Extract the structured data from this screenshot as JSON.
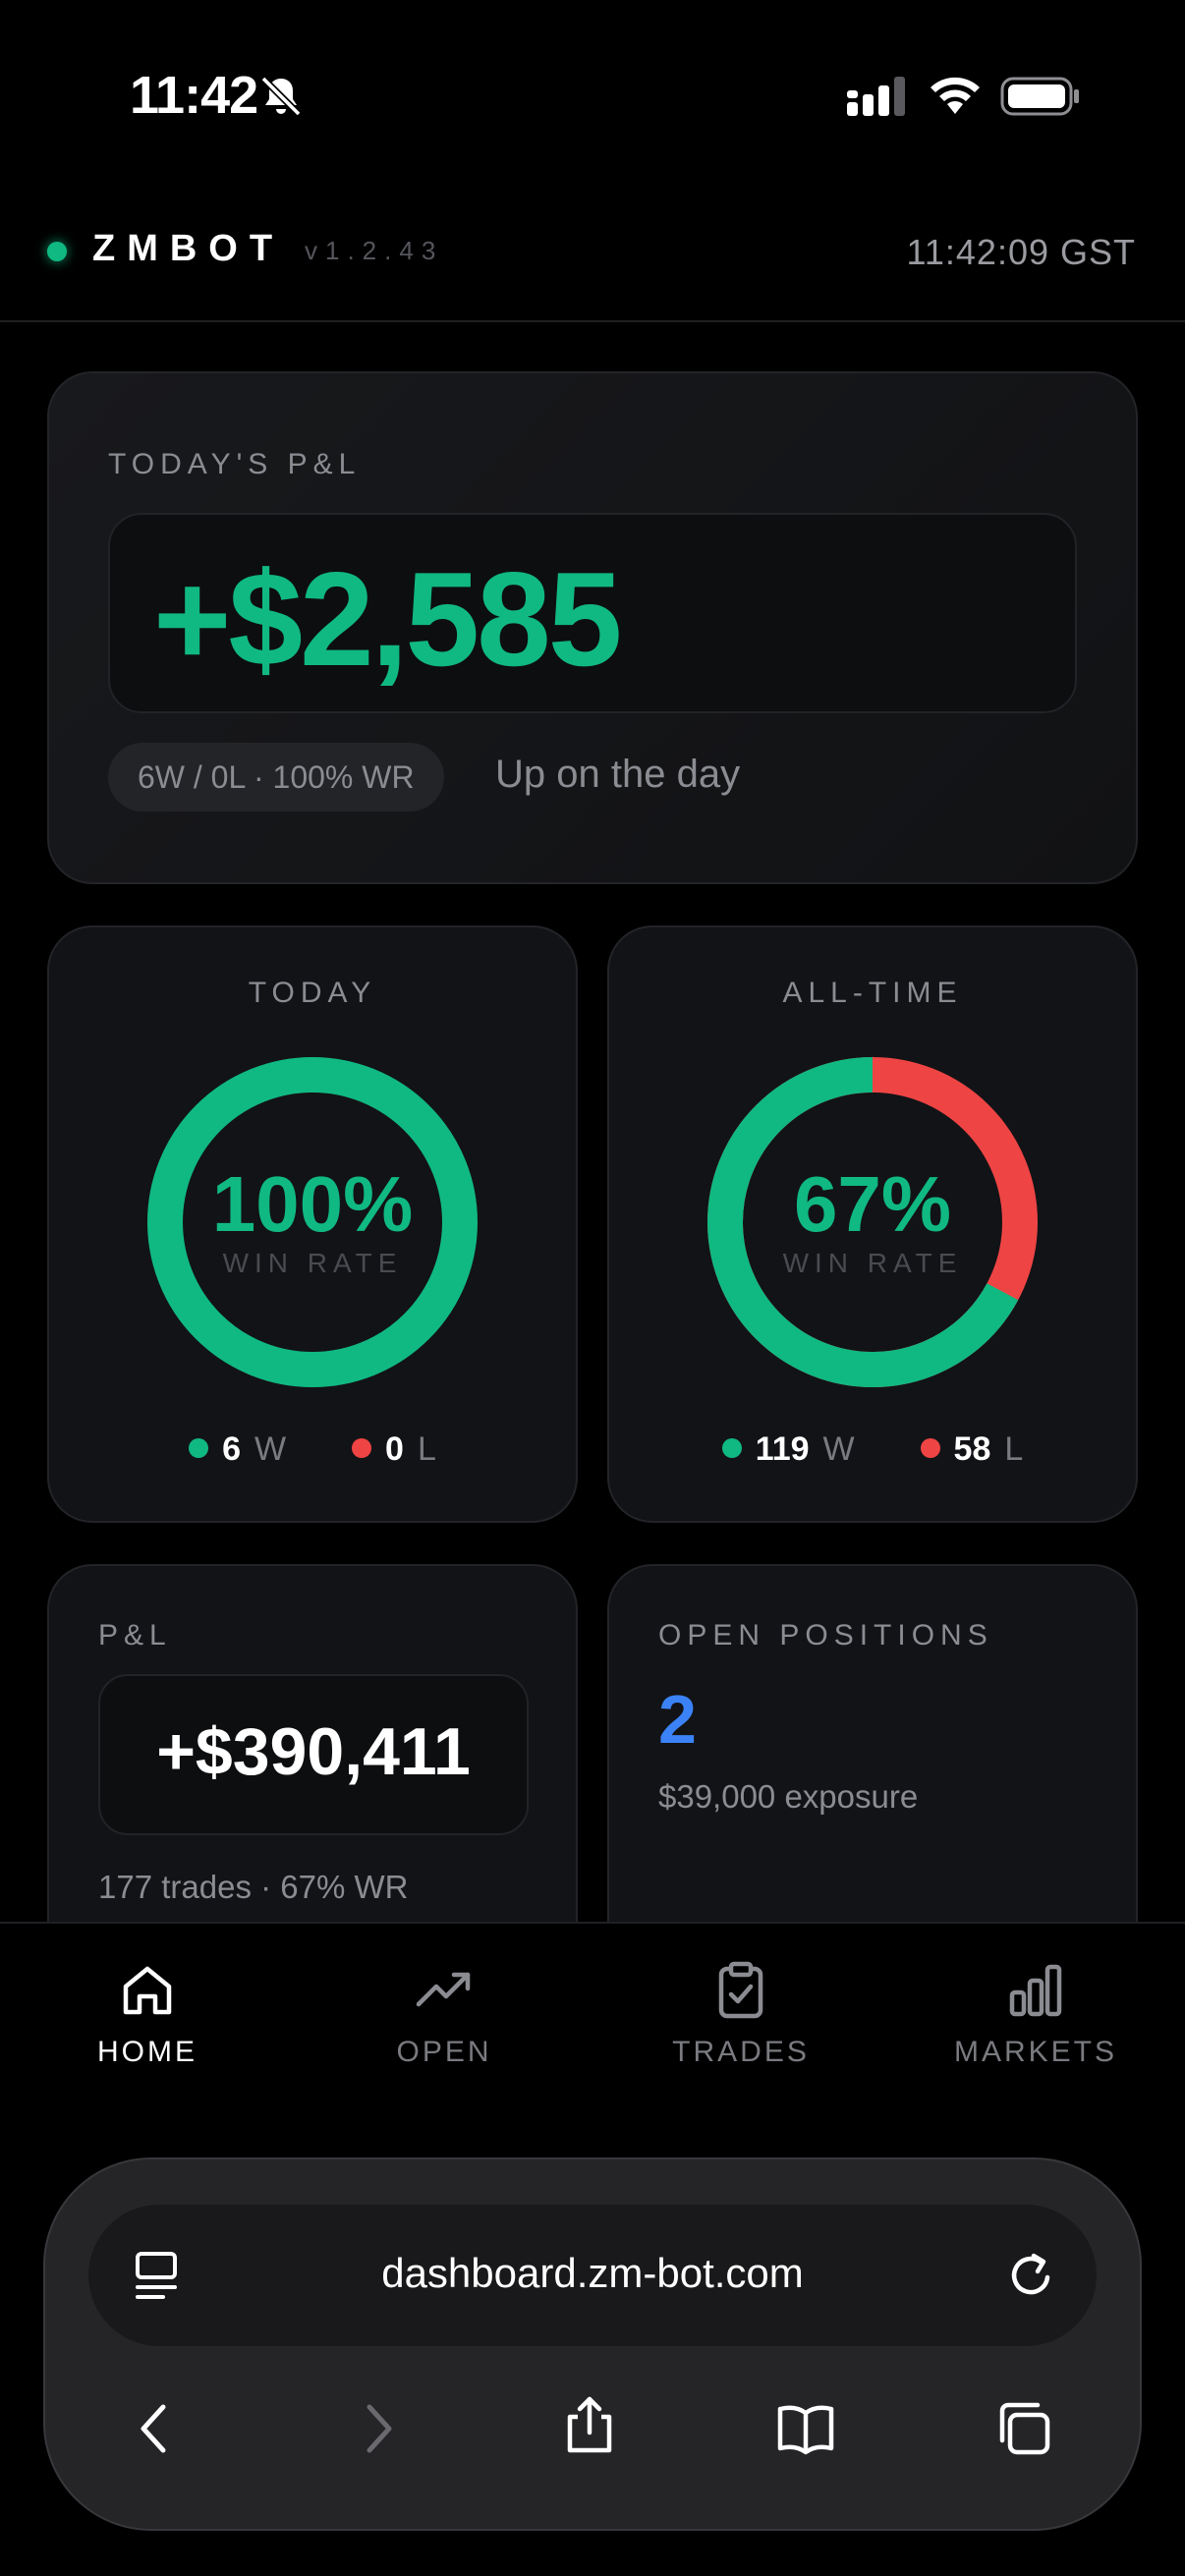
{
  "status_bar": {
    "time": "11:42"
  },
  "header": {
    "brand": "ZMBOT",
    "version": "v1.2.43",
    "clock": "11:42:09 GST"
  },
  "pnl_today": {
    "label": "TODAY'S P&L",
    "value": "+$2,585",
    "record_pill": "6W / 0L · 100% WR",
    "note": "Up on the day"
  },
  "win_rate_today": {
    "label": "TODAY",
    "percent": "100%",
    "sub": "WIN RATE",
    "fraction": 1.0,
    "wins": "6",
    "win_unit": "W",
    "losses": "0",
    "loss_unit": "L"
  },
  "win_rate_all": {
    "label": "ALL-TIME",
    "percent": "67%",
    "sub": "WIN RATE",
    "fraction": 0.672,
    "wins": "119",
    "win_unit": "W",
    "losses": "58",
    "loss_unit": "L"
  },
  "pnl_total": {
    "label": "P&L",
    "value": "+$390,411",
    "meta": "177 trades · 67% WR"
  },
  "open_positions": {
    "label": "OPEN POSITIONS",
    "count": "2",
    "exposure": "$39,000 exposure"
  },
  "nav": [
    {
      "label": "HOME",
      "icon": "home-icon",
      "active": true
    },
    {
      "label": "OPEN",
      "icon": "trending-up-icon",
      "active": false
    },
    {
      "label": "TRADES",
      "icon": "clipboard-check-icon",
      "active": false
    },
    {
      "label": "MARKETS",
      "icon": "bar-chart-icon",
      "active": false
    }
  ],
  "browser": {
    "url": "dashboard.zm-bot.com"
  },
  "colors": {
    "win": "#10b981",
    "loss": "#ef4444",
    "accent_blue": "#3b82f6",
    "ring_track": "#1c1d20"
  }
}
